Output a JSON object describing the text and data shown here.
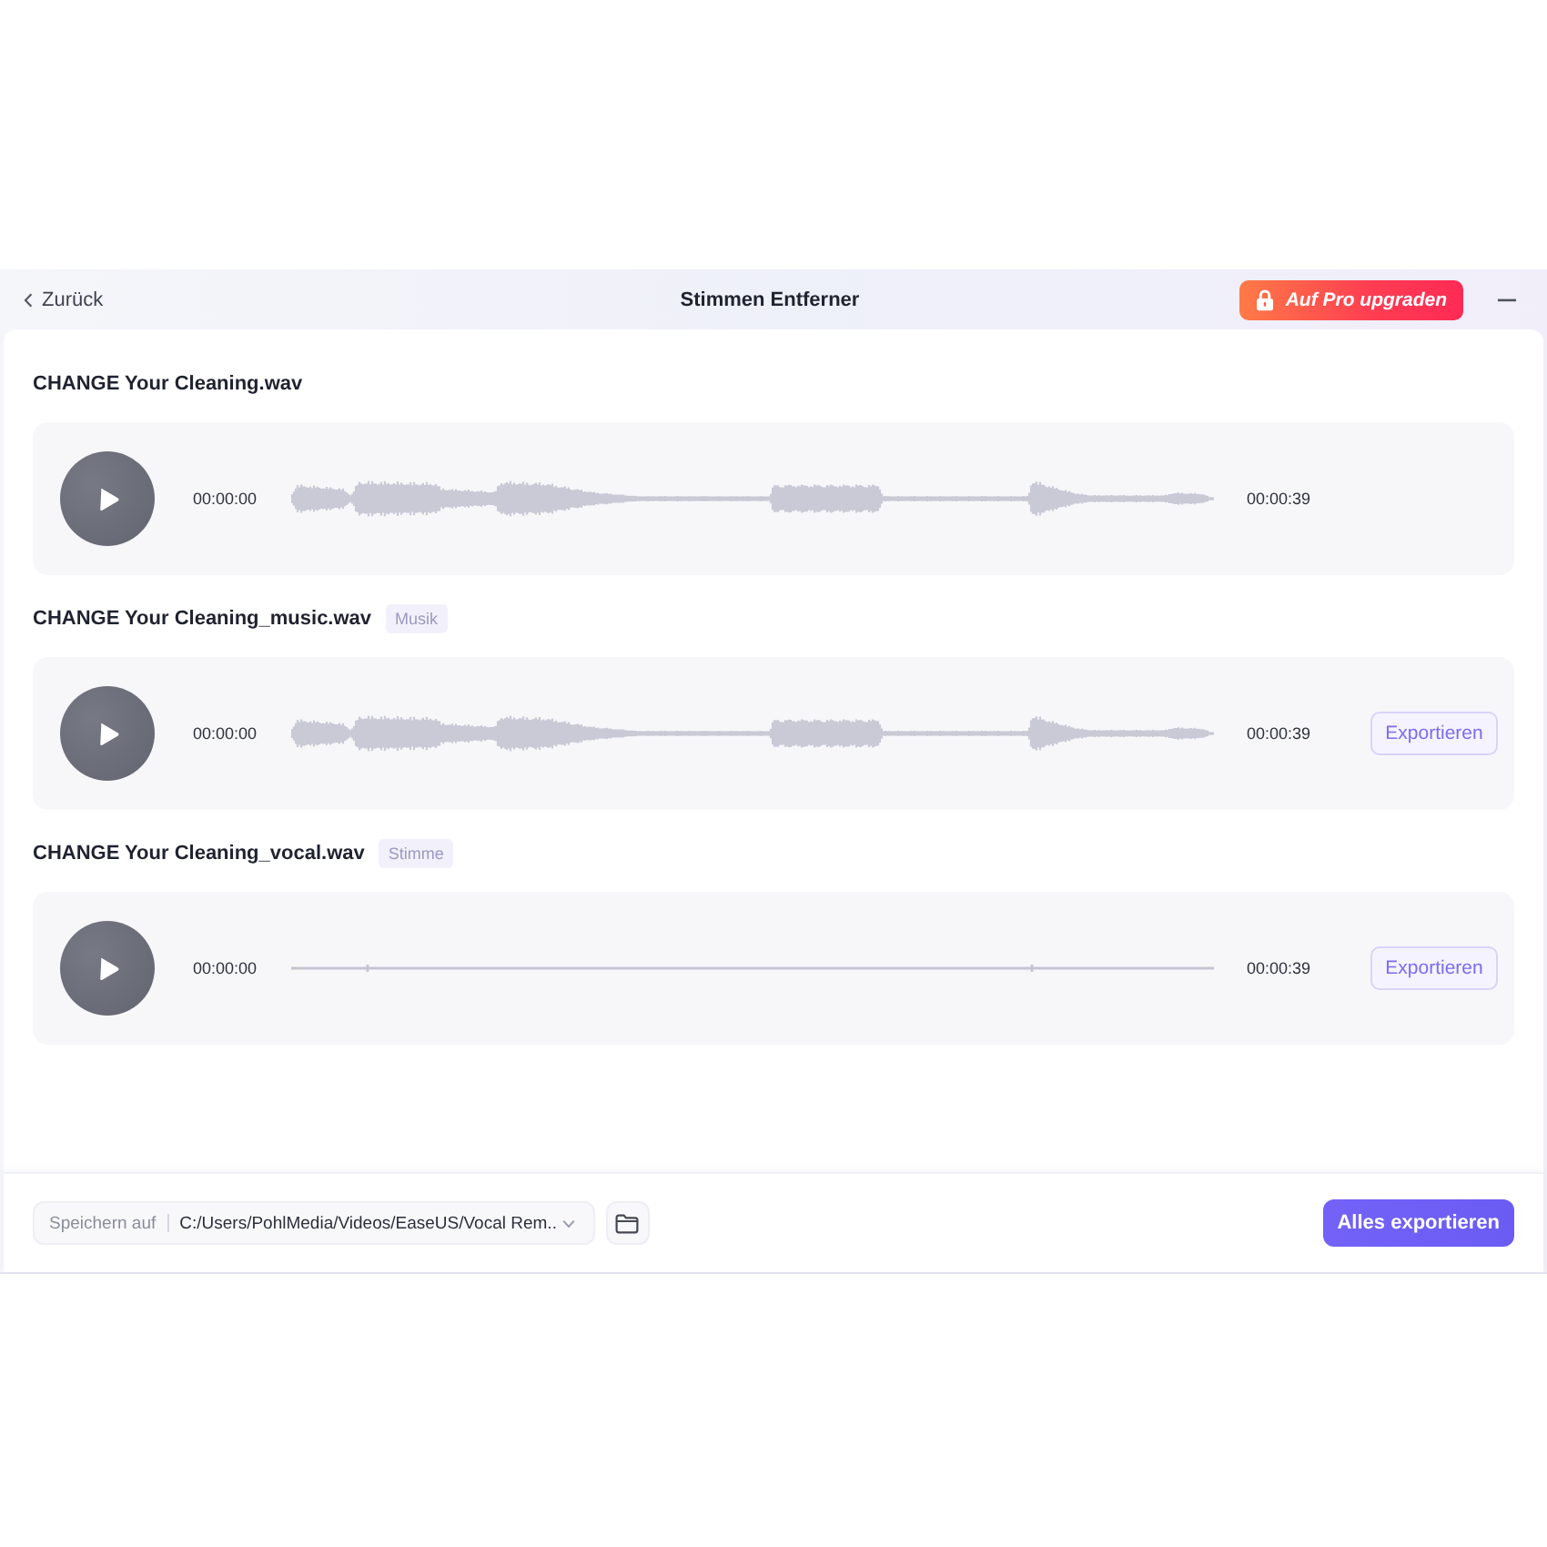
{
  "window": {
    "title": "Stimmen Entferner"
  },
  "title_bar": {
    "back": "Zurück",
    "upgrade_button": "Auf Pro upgraden"
  },
  "tracks": [
    {
      "name": "CHANGE Your Cleaning.wav",
      "kind": "audio",
      "start_time": "00:00:00",
      "end_time": "00:00:39"
    },
    {
      "name": "CHANGE Your Cleaning_music.wav",
      "tag": "Musik",
      "kind": "audio",
      "start_time": "00:00:00",
      "end_time": "00:00:39",
      "export_button": "Exportieren"
    },
    {
      "name": "CHANGE Your Cleaning_vocal.wav",
      "tag": "Stimme",
      "kind": "silence",
      "start_time": "00:00:00",
      "end_time": "00:00:39",
      "export_button": "Exportieren"
    }
  ],
  "footer": {
    "save_label": "Speichern auf",
    "save_path": "C:/Users/PohlMedia/Videos/EaseUS/Vocal Rem..",
    "export_all_button": "Alles exportieren"
  }
}
